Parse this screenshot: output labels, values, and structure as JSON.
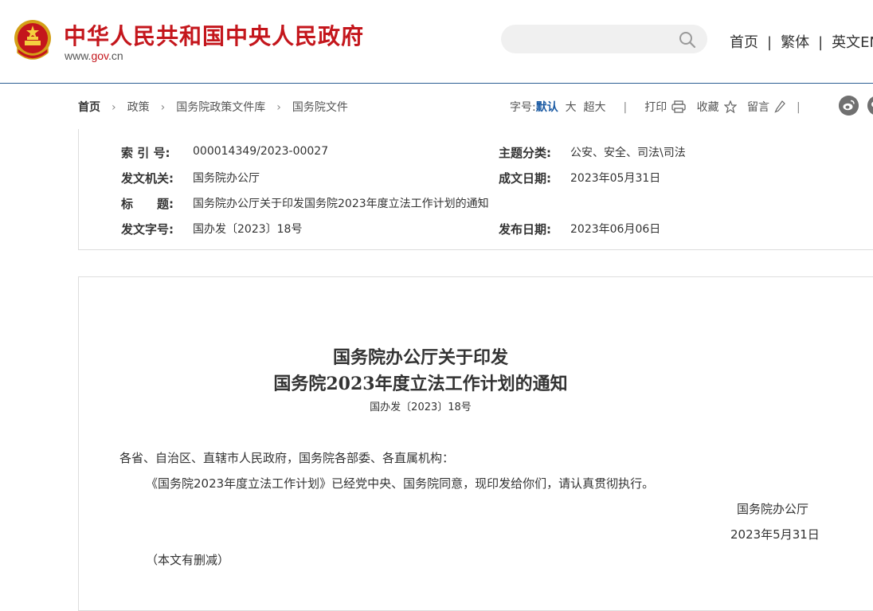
{
  "header": {
    "site_title": "中华人民共和国中央人民政府",
    "site_domain_prefix": "www.",
    "site_domain_gov": "gov",
    "site_domain_suffix": ".cn",
    "search_placeholder": "",
    "nav": [
      "首页",
      "繁体",
      "英文EN"
    ],
    "nav_sep": "|"
  },
  "breadcrumb": {
    "items": [
      "首页",
      "政策",
      "国务院政策文件库",
      "国务院文件"
    ],
    "arrow": "›"
  },
  "tools": {
    "font_label": "字号:",
    "font_default": "默认",
    "font_large": "大",
    "font_xlarge": "超大",
    "print": "打印",
    "collect": "收藏",
    "comment": "留言",
    "sep": "|"
  },
  "info": {
    "index_label": "索 引 号:",
    "index_value": "000014349/2023-00027",
    "topic_label": "主题分类:",
    "topic_value": "公安、安全、司法\\司法",
    "issuer_label": "发文机关:",
    "issuer_value": "国务院办公厅",
    "date_written_label": "成文日期:",
    "date_written_value": "2023年05月31日",
    "title_label": "标　　题:",
    "title_value": "国务院办公厅关于印发国务院2023年度立法工作计划的通知",
    "doc_no_label": "发文字号:",
    "doc_no_value": "国办发〔2023〕18号",
    "publish_label": "发布日期:",
    "publish_value": "2023年06月06日"
  },
  "article": {
    "title_line1": "国务院办公厅关于印发",
    "title_line2": "国务院2023年度立法工作计划的通知",
    "doc_no": "国办发〔2023〕18号",
    "salutation": "各省、自治区、直辖市人民政府，国务院各部委、各直属机构：",
    "body": "《国务院2023年度立法工作计划》已经党中央、国务院同意，现印发给你们，请认真贯彻执行。",
    "signature": "国务院办公厅",
    "date": "2023年5月31日",
    "note": "（本文有删减）"
  },
  "colors": {
    "brand_red": "#c4161c",
    "link_blue": "#1a5aa3",
    "header_border": "#2c5d93"
  }
}
